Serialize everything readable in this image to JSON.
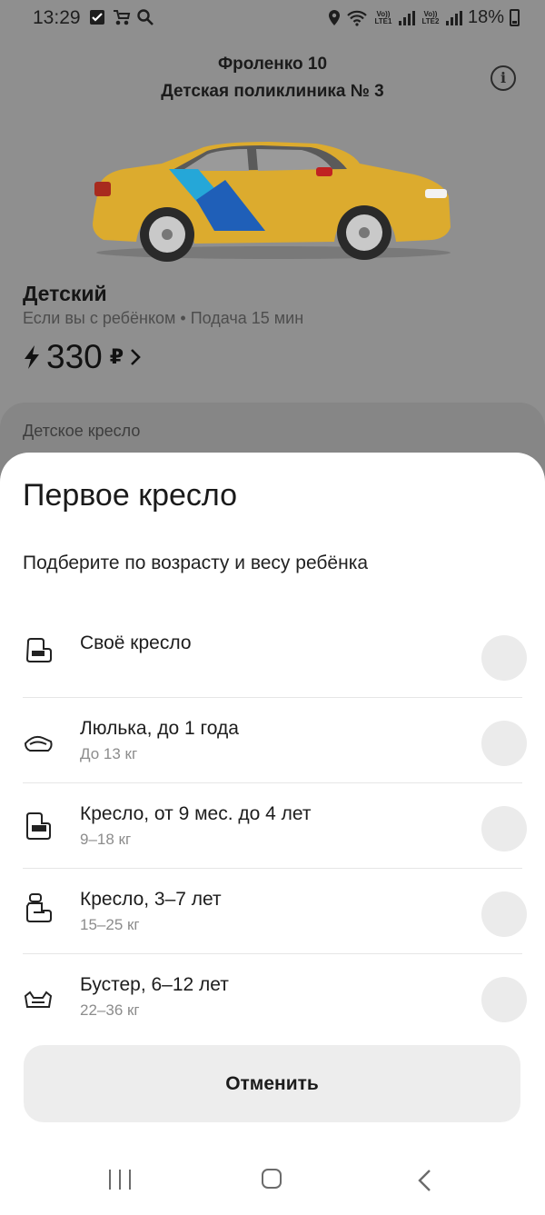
{
  "status_bar": {
    "time": "13:29",
    "battery": "18%",
    "sim1": "Vo)) LTE1",
    "sim2": "Vo)) LTE2",
    "icons": [
      "checkbox-icon",
      "stroller-icon",
      "search-icon",
      "location-icon",
      "wifi-icon",
      "signal-icon",
      "battery-icon"
    ]
  },
  "header": {
    "address_line1": "Фроленко 10",
    "address_line2": "Детская поликлиника № 3",
    "info_icon": "i"
  },
  "tariff": {
    "name": "Детский",
    "subtitle": "Если вы с ребёнком • Подача 15 мин",
    "price": "330",
    "currency": "₽"
  },
  "background_section": {
    "label": "Детское кресло"
  },
  "sheet": {
    "title": "Первое кресло",
    "subtitle": "Подберите по возрасту и весу ребёнка",
    "options": [
      {
        "title": "Своё кресло",
        "desc": "",
        "icon": "own-seat-icon"
      },
      {
        "title": "Люлька, до 1 года",
        "desc": "До 13 кг",
        "icon": "cradle-icon"
      },
      {
        "title": "Кресло, от 9 мес. до 4 лет",
        "desc": "9–18 кг",
        "icon": "infant-seat-icon"
      },
      {
        "title": "Кресло, 3–7 лет",
        "desc": "15–25 кг",
        "icon": "child-seat-icon"
      },
      {
        "title": "Бустер, 6–12 лет",
        "desc": "22–36 кг",
        "icon": "booster-icon"
      }
    ],
    "cancel_label": "Отменить"
  },
  "colors": {
    "car_body": "#e2ad2a",
    "brand_blue": "#1f5fb8",
    "brand_cyan": "#25a7d8",
    "overlay": "#8f8f8f"
  }
}
